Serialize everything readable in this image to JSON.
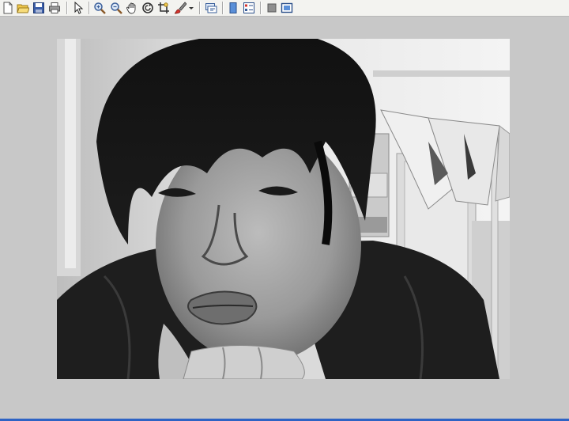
{
  "toolbar": {
    "buttons": [
      {
        "icon": "new-document-icon"
      },
      {
        "icon": "open-folder-icon"
      },
      {
        "icon": "save-icon"
      },
      {
        "icon": "print-icon"
      },
      {
        "icon": "select-pointer-icon"
      },
      {
        "icon": "zoom-in-icon"
      },
      {
        "icon": "zoom-out-icon"
      },
      {
        "icon": "pan-hand-icon"
      },
      {
        "icon": "rotate-icon"
      },
      {
        "icon": "crop-icon"
      },
      {
        "icon": "paint-brush-icon"
      },
      {
        "icon": "dropdown-arrow-icon"
      },
      {
        "icon": "slideshow-icon"
      },
      {
        "icon": "single-page-icon"
      },
      {
        "icon": "thumbnails-icon"
      },
      {
        "icon": "stop-icon"
      },
      {
        "icon": "fullscreen-icon"
      }
    ]
  },
  "colors": {
    "background": "#c8c8c8",
    "toolbar": "#f3f3f0",
    "accent": "#2e63c4"
  }
}
